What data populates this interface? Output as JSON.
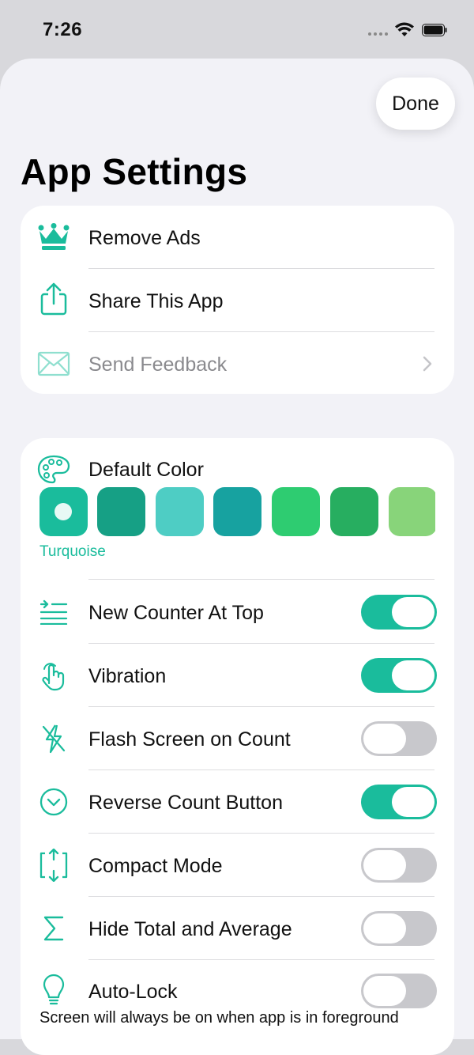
{
  "status_bar": {
    "time": "7:26"
  },
  "header": {
    "done_label": "Done",
    "title": "App Settings"
  },
  "colors": {
    "accent": "#1abc9c",
    "off_toggle": "#c8c8cc"
  },
  "general_items": [
    {
      "label": "Remove Ads",
      "icon": "crown-icon"
    },
    {
      "label": "Share This App",
      "icon": "share-icon"
    },
    {
      "label": "Send Feedback",
      "icon": "envelope-icon",
      "disabled": true,
      "chevron": true
    }
  ],
  "default_color": {
    "label": "Default Color",
    "icon": "palette-icon",
    "selected_name": "Turquoise",
    "swatches": [
      "#1abc9c",
      "#16a085",
      "#4ecdc4",
      "#17a2a0",
      "#2ecc71",
      "#27ae60",
      "#88d47a"
    ],
    "selected_index": 0
  },
  "toggles": [
    {
      "label": "New Counter At Top",
      "icon": "list-insert-icon",
      "on": true
    },
    {
      "label": "Vibration",
      "icon": "hand-tap-icon",
      "on": true
    },
    {
      "label": "Flash Screen on Count",
      "icon": "flash-off-icon",
      "on": false
    },
    {
      "label": "Reverse Count Button",
      "icon": "chevron-down-circle-icon",
      "on": true
    },
    {
      "label": "Compact Mode",
      "icon": "compact-icon",
      "on": false
    },
    {
      "label": "Hide Total and Average",
      "icon": "sigma-icon",
      "on": false
    },
    {
      "label": "Auto-Lock",
      "icon": "lightbulb-icon",
      "on": false
    }
  ],
  "auto_lock_note": "Screen will always be on when app is in foreground"
}
